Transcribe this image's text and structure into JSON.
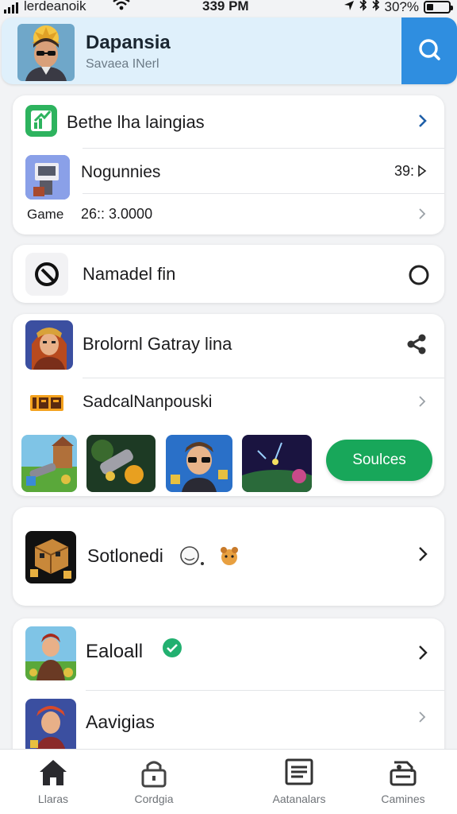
{
  "status": {
    "carrier": "lerdeanoik",
    "time": "339 PM",
    "battery_text": "30?%",
    "battery_level": 0.3
  },
  "header": {
    "title": "Dapansia",
    "subtitle": "Savaea INerl"
  },
  "card1": {
    "title": "Bethe lha laingias",
    "row2_label": "Nogunnies",
    "row2_value": "39:",
    "row3_label": "Game",
    "row3_value": "26:: 3.0000"
  },
  "card2": {
    "label": "Namadel fin"
  },
  "card3": {
    "title": "Brolornl Gatray lina",
    "row2_label": "SadcalNanpouski",
    "action_button": "Soulces"
  },
  "card4": {
    "label": "Sotlonedi"
  },
  "card5": {
    "row1_label": "Ealoall",
    "row2_label": "Aavigias"
  },
  "tabs": [
    {
      "label": "Llaras",
      "icon": "home-icon"
    },
    {
      "label": "Cordgia",
      "icon": "lock-icon"
    },
    {
      "label": "Aatanalars",
      "icon": "list-icon"
    },
    {
      "label": "Camines",
      "icon": "tray-icon"
    }
  ],
  "colors": {
    "accent_blue": "#2f8ee0",
    "action_green": "#18a75a",
    "header_bg": "#dff0fb",
    "app_green": "#2db35e"
  }
}
